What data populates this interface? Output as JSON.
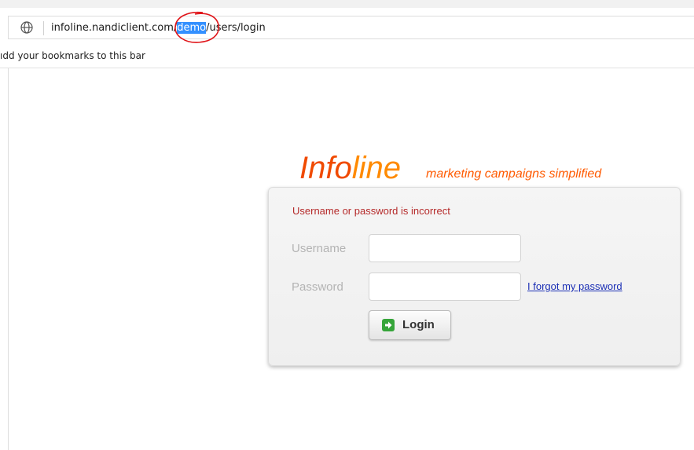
{
  "browser": {
    "url_prefix": "infoline.nandiclient.com/",
    "url_selected": "demo",
    "url_suffix": "/users/login",
    "bookmarks_bar_text": "ıdd your bookmarks to this bar",
    "url_highlight_color": "#3390ff",
    "annotation_circle_color": "#e0161b"
  },
  "logo": {
    "part_info": "Info",
    "part_line": "line",
    "tagline": "marketing campaigns simplified",
    "colors": {
      "info": "#f04a00",
      "line": "#ff8a00"
    }
  },
  "login_form": {
    "error_message": "Username or password is incorrect",
    "username_label": "Username",
    "username_value": "",
    "password_label": "Password",
    "password_value": "",
    "forgot_link": "I forgot my password",
    "login_button": "Login",
    "login_icon": "arrow-right-icon"
  }
}
